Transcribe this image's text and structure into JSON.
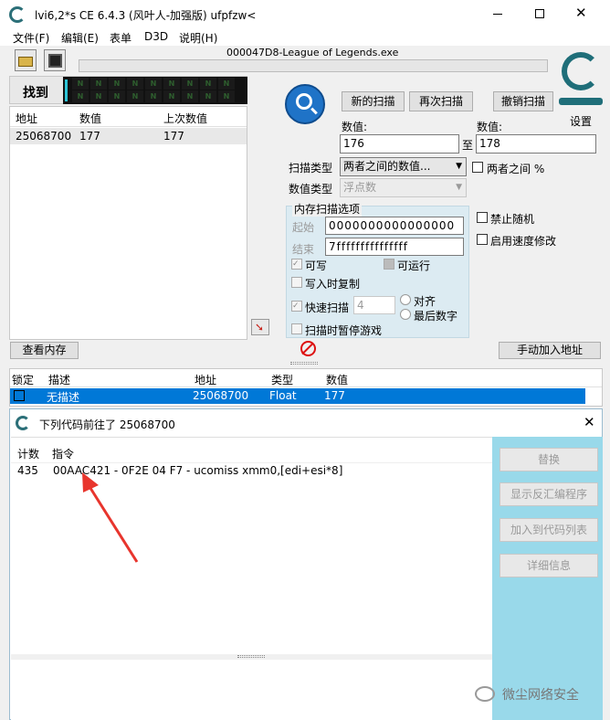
{
  "titlebar": {
    "title": "lvi6,2*s   CE 6.4.3 (风叶人-加强版)   ufpfzw<"
  },
  "menu": [
    "文件(F)",
    "编辑(E)",
    "表单",
    "D3D",
    "说明(H)"
  ],
  "process_name": "000047D8-League of Legends.exe",
  "settings_label": "设置",
  "found": {
    "label": "找到",
    "columns": [
      "地址",
      "数值",
      "上次数值"
    ],
    "rows": [
      {
        "address": "25068700",
        "value": "177",
        "prev": "177"
      }
    ]
  },
  "scan": {
    "new_scan": "新的扫描",
    "next_scan": "再次扫描",
    "undo_scan": "撤销扫描",
    "value_label": "数值:",
    "value_label2": "数值:",
    "value1": "176",
    "value2": "178",
    "to": "至",
    "scan_type_label": "扫描类型",
    "scan_type": "两者之间的数值...",
    "between_pct": "两者之间 %",
    "value_type_label": "数值类型",
    "value_type": "浮点数",
    "mem_options": "内存扫描选项",
    "start_label": "起始",
    "start_value": "0000000000000000",
    "stop_label": "结束",
    "stop_value": "7fffffffffffffff",
    "writable": "可写",
    "executable": "可运行",
    "copy_on_write": "写入时复制",
    "fast_scan": "快速扫描",
    "fast_scan_value": "4",
    "align": "对齐",
    "last_digits": "最后数字",
    "pause_game": "扫描时暂停游戏",
    "no_random": "禁止随机",
    "speedhack": "启用速度修改"
  },
  "view_memory": "查看内存",
  "add_address": "手动加入地址",
  "address_list": {
    "columns": [
      "锁定",
      "描述",
      "地址",
      "类型",
      "数值"
    ],
    "rows": [
      {
        "desc": "无描述",
        "address": "25068700",
        "type": "Float",
        "value": "177"
      }
    ]
  },
  "dialog": {
    "title": "下列代码前往了 25068700",
    "columns": [
      "计数",
      "指令"
    ],
    "rows": [
      {
        "count": "435",
        "instruction": "00AAC421 - 0F2E 04 F7  - ucomiss xmm0,[edi+esi*8]"
      }
    ],
    "buttons": [
      "替换",
      "显示反汇编程序",
      "加入到代码列表",
      "详细信息"
    ]
  },
  "watermark": "微尘网络安全",
  "colors": {
    "selection": "#0078d7",
    "dialog_panel": "#99d9ea",
    "arrow": "#e8352d"
  }
}
